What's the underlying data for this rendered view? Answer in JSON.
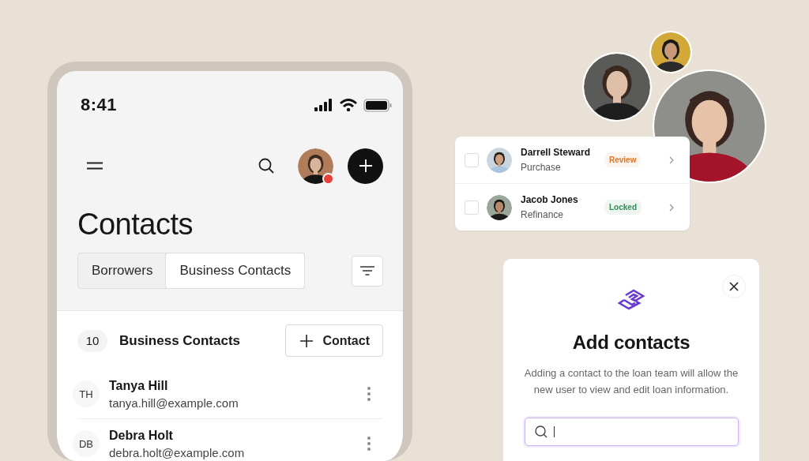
{
  "status_bar": {
    "time": "8:41"
  },
  "app_bar": {
    "notification": true
  },
  "title": "Contacts",
  "tabs": [
    {
      "label": "Borrowers",
      "selected": false
    },
    {
      "label": "Business Contacts",
      "selected": true
    }
  ],
  "section": {
    "count": "10",
    "title": "Business Contacts",
    "add_button": "Contact"
  },
  "contacts": [
    {
      "initials": "TH",
      "name": "Tanya Hill",
      "email": "tanya.hill@example.com"
    },
    {
      "initials": "DB",
      "name": "Debra Holt",
      "email": "debra.holt@example.com"
    }
  ],
  "loan_card": {
    "rows": [
      {
        "name": "Darrell Steward",
        "loan_type": "Purchase",
        "status": "Review",
        "color": "#d9782d",
        "checked": false
      },
      {
        "name": "Jacob Jones",
        "loan_type": "Refinance",
        "status": "Locked",
        "color": "#2f8a55",
        "checked": false
      }
    ]
  },
  "dialog": {
    "title": "Add contacts",
    "description": "Adding a contact to the loan team will allow the new user to view and edit loan information.",
    "search": {
      "focused": true,
      "caret": true
    }
  }
}
